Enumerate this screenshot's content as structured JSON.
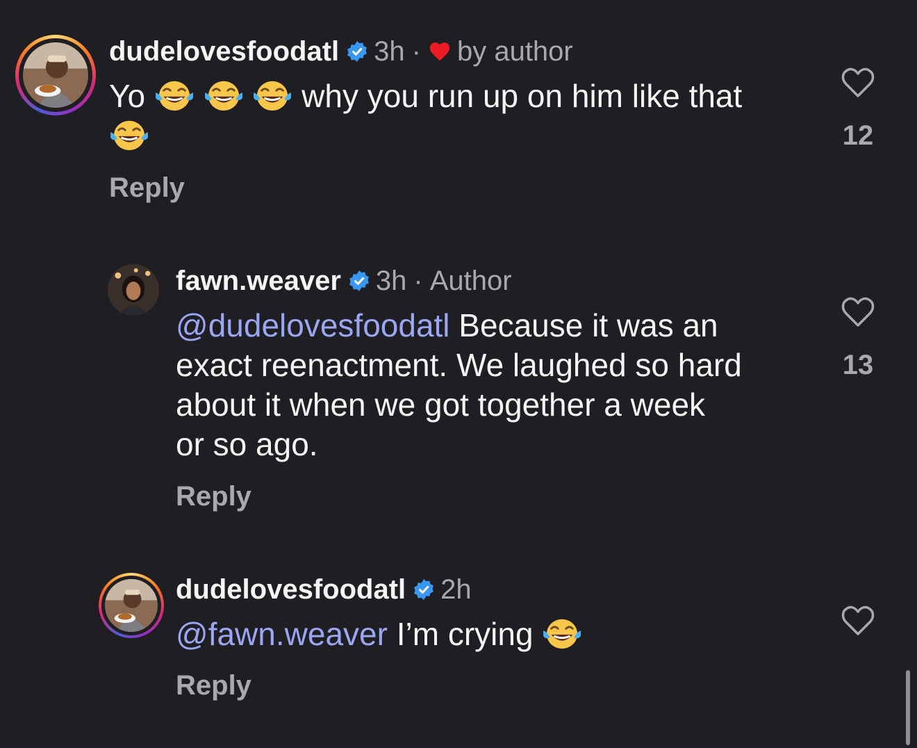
{
  "colors": {
    "background": "#1f1f23",
    "text": "#f5f5f5",
    "muted": "#a8a8ae",
    "mention": "#9aa6f2",
    "verified": "#3897f0",
    "liked_heart": "#ed1c24"
  },
  "comments": [
    {
      "username": "dudelovesfoodatl",
      "verified": true,
      "time": "3h",
      "separator": "·",
      "liked_by_author_label": "by author",
      "text_prefix": "Yo",
      "text_middle": " why you run up on him like that",
      "emojis": [
        "face-with-tears-of-joy",
        "face-with-tears-of-joy",
        "face-with-tears-of-joy",
        "face-with-tears-of-joy"
      ],
      "reply_label": "Reply",
      "like_count": "12"
    },
    {
      "username": "fawn.weaver",
      "verified": true,
      "time": "3h",
      "separator": "·",
      "author_label": "Author",
      "mention": "@dudelovesfoodatl",
      "text_line1": " Because it was an",
      "text_line2": "exact reenactment. We laughed so hard",
      "text_line3": "about it when we got together a week",
      "text_line4": "or so ago.",
      "reply_label": "Reply",
      "like_count": "13"
    },
    {
      "username": "dudelovesfoodatl",
      "verified": true,
      "time": "2h",
      "mention": "@fawn.weaver",
      "text": " I’m crying ",
      "emojis": [
        "face-with-tears-of-joy"
      ],
      "reply_label": "Reply",
      "like_count": ""
    }
  ]
}
